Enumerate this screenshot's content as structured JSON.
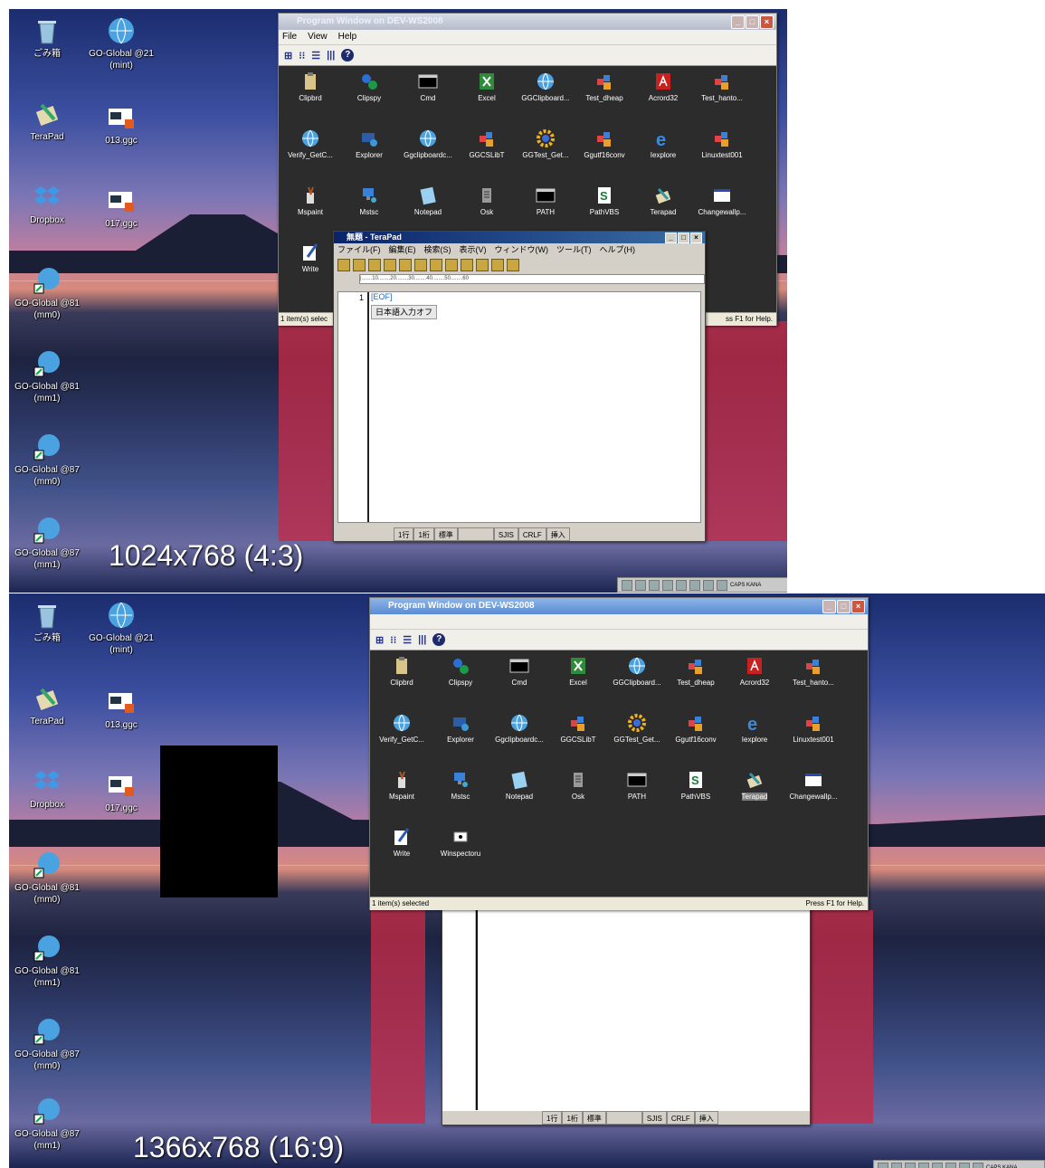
{
  "desktop_icons": [
    {
      "label": "ごみ箱",
      "icon": "recycle-bin-icon"
    },
    {
      "label": "GO-Global @21\n(mint)",
      "icon": "globe-icon"
    },
    {
      "label": "TeraPad",
      "icon": "terapad-icon"
    },
    {
      "label": "013.ggc",
      "icon": "ggc-file-icon"
    },
    {
      "label": "Dropbox",
      "icon": "dropbox-icon"
    },
    {
      "label": "017.ggc",
      "icon": "ggc-file-icon"
    },
    {
      "label": "GO-Global @81\n(mm0)",
      "icon": "globe-shortcut-icon"
    },
    {
      "label": "GO-Global @81\n(mm1)",
      "icon": "globe-shortcut-icon"
    },
    {
      "label": "GO-Global @87\n(mm0)",
      "icon": "globe-shortcut-icon"
    },
    {
      "label": "GO-Global @87\n(mm1)",
      "icon": "globe-shortcut-icon"
    }
  ],
  "top": {
    "resolution_label": "1024x768 (4:3)",
    "window_title": "Program Window on DEV-WS2008",
    "menu": [
      "File",
      "View",
      "Help"
    ],
    "status_left": "1 item(s) selec",
    "status_right": "ss F1 for Help."
  },
  "bottom": {
    "resolution_label": "1366x768 (16:9)",
    "window_title": "Program Window on DEV-WS2008",
    "status_left": "1 item(s) selected",
    "status_right": "Press F1 for Help."
  },
  "programs": [
    {
      "label": "Clipbrd",
      "icon": "clipboard-icon"
    },
    {
      "label": "Clipspy",
      "icon": "clipspy-icon"
    },
    {
      "label": "Cmd",
      "icon": "cmd-icon"
    },
    {
      "label": "Excel",
      "icon": "excel-icon"
    },
    {
      "label": "GGClipboard...",
      "icon": "globe-icon"
    },
    {
      "label": "Test_dheap",
      "icon": "app-blocks-icon"
    },
    {
      "label": "Acrord32",
      "icon": "acrobat-icon"
    },
    {
      "label": "Test_hanto...",
      "icon": "app-blocks-icon"
    },
    {
      "label": "Verify_GetC...",
      "icon": "globe-icon"
    },
    {
      "label": "Explorer",
      "icon": "explorer-icon"
    },
    {
      "label": "Ggclipboardc...",
      "icon": "globe-icon"
    },
    {
      "label": "GGCSLibT",
      "icon": "app-blocks-icon"
    },
    {
      "label": "GGTest_Get...",
      "icon": "gear-icon"
    },
    {
      "label": "Ggutf16conv",
      "icon": "app-blocks-icon"
    },
    {
      "label": "Iexplore",
      "icon": "ie-icon"
    },
    {
      "label": "Linuxtest001",
      "icon": "app-blocks-icon"
    },
    {
      "label": "Mspaint",
      "icon": "paint-icon"
    },
    {
      "label": "Mstsc",
      "icon": "remote-desktop-icon"
    },
    {
      "label": "Notepad",
      "icon": "notepad-icon"
    },
    {
      "label": "Osk",
      "icon": "keyboard-icon"
    },
    {
      "label": "PATH",
      "icon": "cmd-icon"
    },
    {
      "label": "PathVBS",
      "icon": "script-icon"
    },
    {
      "label": "Terapad",
      "icon": "terapad-icon"
    },
    {
      "label": "Changewallp...",
      "icon": "window-icon"
    },
    {
      "label": "Write",
      "icon": "write-icon"
    },
    {
      "label": "Winspectoru",
      "icon": "inspector-icon"
    }
  ],
  "terapad": {
    "title": "無題 - TeraPad",
    "menu": [
      "ファイル(F)",
      "編集(E)",
      "検索(S)",
      "表示(V)",
      "ウィンドウ(W)",
      "ツール(T)",
      "ヘルプ(H)"
    ],
    "line_number": "1",
    "eof": "[EOF]",
    "ime": "日本語入力オフ",
    "ruler": "|.......10........20........30........40........50........60",
    "status": [
      "1行",
      "1桁",
      "標準",
      "SJIS",
      "CRLF",
      "挿入"
    ]
  },
  "taskbar": {
    "caps": "CAPS KANA"
  },
  "colors": {
    "selection": "#7d7d7d",
    "red_band": "#c42a46",
    "grid_bg": "#2c2c2c"
  }
}
